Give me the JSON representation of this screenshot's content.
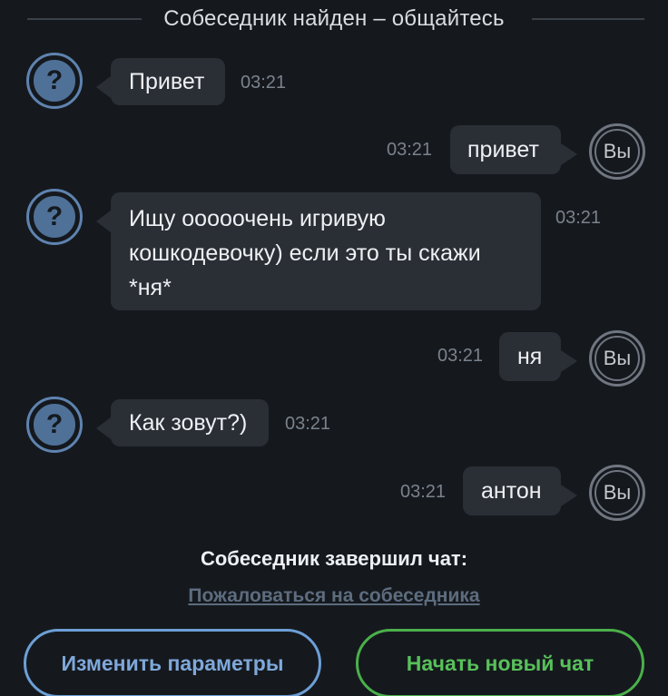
{
  "header": {
    "status_text": "Собеседник найден – общайтесь"
  },
  "messages": [
    {
      "from": "stranger",
      "avatar": "?",
      "lines": [
        "Привет"
      ],
      "time": "03:21"
    },
    {
      "from": "me",
      "avatar": "Вы",
      "lines": [
        "привет"
      ],
      "time": "03:21"
    },
    {
      "from": "stranger",
      "avatar": "?",
      "lines": [
        "Ищу ооооочень игривую",
        "кошкодевочку) если это ты скажи",
        "*ня*"
      ],
      "time": "03:21"
    },
    {
      "from": "me",
      "avatar": "Вы",
      "lines": [
        "ня"
      ],
      "time": "03:21"
    },
    {
      "from": "stranger",
      "avatar": "?",
      "lines": [
        "Как зовут?)"
      ],
      "time": "03:21"
    },
    {
      "from": "me",
      "avatar": "Вы",
      "lines": [
        "антон"
      ],
      "time": "03:21"
    }
  ],
  "footer": {
    "ended_text": "Собеседник завершил чат:",
    "report_link": "Пожаловаться на собеседника",
    "change_params_button": "Изменить параметры",
    "new_chat_button": "Начать новый чат"
  },
  "colors": {
    "background": "#15191e",
    "bubble": "#2a2f36",
    "stranger_avatar": "#4f7198",
    "params_button": "#6d9fd6",
    "new_chat_button": "#4bb04a"
  }
}
